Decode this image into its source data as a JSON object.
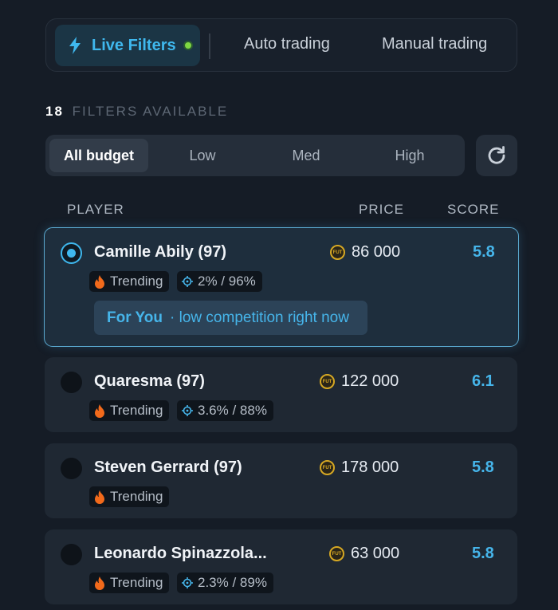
{
  "tabs": {
    "live": "Live Filters",
    "auto": "Auto trading",
    "manual": "Manual trading"
  },
  "filters": {
    "count": "18",
    "label": "FILTERS AVAILABLE"
  },
  "budget": {
    "options": [
      "All budget",
      "Low",
      "Med",
      "High"
    ],
    "selected": "All budget"
  },
  "table": {
    "headers": {
      "player": "PLAYER",
      "price": "PRICE",
      "score": "SCORE"
    }
  },
  "players": [
    {
      "name": "Camille Abily (97)",
      "price": "86 000",
      "score": "5.8",
      "trend": "Trending",
      "stat": "2% / 96%",
      "selected": true,
      "for_you": "For You",
      "for_you_text": "· low competition right now"
    },
    {
      "name": "Quaresma (97)",
      "price": "122 000",
      "score": "6.1",
      "trend": "Trending",
      "stat": "3.6% / 88%",
      "selected": false
    },
    {
      "name": "Steven Gerrard (97)",
      "price": "178 000",
      "score": "5.8",
      "trend": "Trending",
      "selected": false
    },
    {
      "name": "Leonardo Spinazzola...",
      "price": "63 000",
      "score": "5.8",
      "trend": "Trending",
      "stat": "2.3% / 89%",
      "selected": false
    }
  ],
  "coin_text": "FUT",
  "colors": {
    "accent": "#3fb8ee",
    "live_dot": "#7fd842",
    "coin": "#d6a823",
    "flame": "#f26a1b"
  },
  "icons": [
    "bolt-icon",
    "refresh-icon",
    "coin-icon",
    "flame-icon",
    "target-icon"
  ]
}
